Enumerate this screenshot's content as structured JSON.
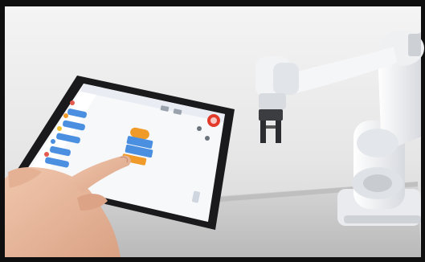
{
  "scene": {
    "subject": "tablet-block-programming-controlling-robot-arm",
    "colors": {
      "frame": "#0f0f10",
      "backdrop_light": "#f1f1f1",
      "backdrop_mid": "#d9d9d9",
      "table": "#c9c9c9",
      "tablet_bezel": "#1a1a1c",
      "screen_bg": "#f7f8fa",
      "block_blue": "#4a8fe0",
      "block_orange": "#f09a2a",
      "stop_button": "#e23b2b",
      "robot_white": "#f3f4f6",
      "robot_joint": "#cfd3d8",
      "skin": "#e8b79b"
    },
    "ui": {
      "palette_blocks": 7,
      "canvas_blocks": 4,
      "palette_block_colors": [
        "#e45a4c",
        "#f09a2a",
        "#f2c230",
        "#4a8fe0",
        "#4a8fe0",
        "#e45a4c",
        "#4a8fe0"
      ]
    }
  }
}
